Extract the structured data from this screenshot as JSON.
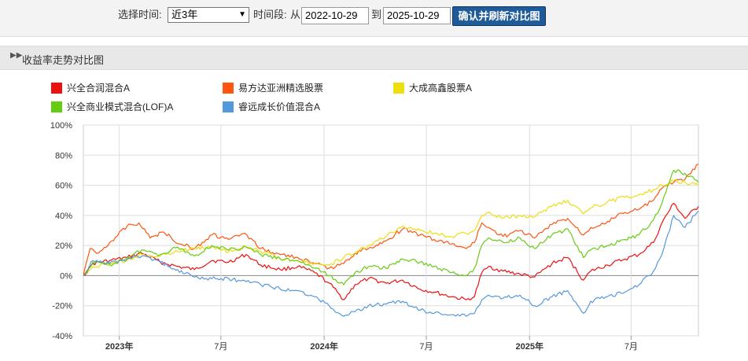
{
  "controls": {
    "period_label": "选择时间:",
    "period_value": "近3年",
    "range_label": "时间段:",
    "from_label": "从",
    "start_date": "2022-10-29",
    "to_label": "到",
    "end_date": "2025-10-29",
    "confirm_button": "确认并刷新对比图"
  },
  "section": {
    "title": "收益率走势对比图"
  },
  "chart_data": {
    "type": "line",
    "title": "",
    "xlabel": "",
    "ylabel": "",
    "x_range": [
      "2022-10-29",
      "2025-10-29"
    ],
    "ylim": [
      -40,
      100
    ],
    "yticks": [
      100,
      80,
      60,
      40,
      20,
      0,
      -20,
      -40
    ],
    "ytick_labels": [
      "100%",
      "80%",
      "60%",
      "40%",
      "20%",
      "0%",
      "-20%",
      "-40%"
    ],
    "xticks": [
      {
        "date": "2023-01-01",
        "label": "2023年",
        "bold": true
      },
      {
        "date": "2023-07-01",
        "label": "7月",
        "bold": false
      },
      {
        "date": "2024-01-01",
        "label": "2024年",
        "bold": true
      },
      {
        "date": "2024-07-01",
        "label": "7月",
        "bold": false
      },
      {
        "date": "2025-01-01",
        "label": "2025年",
        "bold": true
      },
      {
        "date": "2025-07-01",
        "label": "7月",
        "bold": false
      }
    ],
    "grid": true,
    "legend_position": "top",
    "series": [
      {
        "name": "兴全合润混合A",
        "color": "#ee1111",
        "points": [
          [
            "2022-10-29",
            0
          ],
          [
            "2022-11-15",
            8
          ],
          [
            "2022-12-15",
            10
          ],
          [
            "2023-01-15",
            12
          ],
          [
            "2023-02-10",
            15
          ],
          [
            "2023-03-15",
            9
          ],
          [
            "2023-04-15",
            6
          ],
          [
            "2023-05-15",
            4
          ],
          [
            "2023-06-15",
            10
          ],
          [
            "2023-07-15",
            9
          ],
          [
            "2023-08-15",
            14
          ],
          [
            "2023-09-10",
            7
          ],
          [
            "2023-10-15",
            4
          ],
          [
            "2023-11-15",
            6
          ],
          [
            "2023-12-15",
            2
          ],
          [
            "2024-01-10",
            -5
          ],
          [
            "2024-02-05",
            -16
          ],
          [
            "2024-02-25",
            -6
          ],
          [
            "2024-03-20",
            -2
          ],
          [
            "2024-04-20",
            -5
          ],
          [
            "2024-05-20",
            -3
          ],
          [
            "2024-06-20",
            -9
          ],
          [
            "2024-07-15",
            -11
          ],
          [
            "2024-08-15",
            -14
          ],
          [
            "2024-09-10",
            -16
          ],
          [
            "2024-09-25",
            -14
          ],
          [
            "2024-10-08",
            2
          ],
          [
            "2024-10-20",
            6
          ],
          [
            "2024-11-15",
            3
          ],
          [
            "2024-12-15",
            1
          ],
          [
            "2025-01-10",
            -1
          ],
          [
            "2025-02-10",
            8
          ],
          [
            "2025-03-10",
            12
          ],
          [
            "2025-04-07",
            -3
          ],
          [
            "2025-04-20",
            3
          ],
          [
            "2025-05-20",
            7
          ],
          [
            "2025-06-20",
            11
          ],
          [
            "2025-07-15",
            14
          ],
          [
            "2025-08-10",
            22
          ],
          [
            "2025-08-25",
            35
          ],
          [
            "2025-09-15",
            48
          ],
          [
            "2025-10-05",
            38
          ],
          [
            "2025-10-29",
            46
          ]
        ]
      },
      {
        "name": "易方达亚洲精选股票",
        "color": "#ff5511",
        "points": [
          [
            "2022-10-29",
            0
          ],
          [
            "2022-11-10",
            18
          ],
          [
            "2022-11-25",
            15
          ],
          [
            "2022-12-15",
            22
          ],
          [
            "2023-01-15",
            33
          ],
          [
            "2023-02-05",
            35
          ],
          [
            "2023-02-25",
            25
          ],
          [
            "2023-03-20",
            29
          ],
          [
            "2023-04-20",
            21
          ],
          [
            "2023-05-15",
            18
          ],
          [
            "2023-06-15",
            27
          ],
          [
            "2023-07-15",
            24
          ],
          [
            "2023-08-10",
            28
          ],
          [
            "2023-09-10",
            18
          ],
          [
            "2023-10-15",
            14
          ],
          [
            "2023-11-15",
            12
          ],
          [
            "2023-12-15",
            8
          ],
          [
            "2024-01-10",
            5
          ],
          [
            "2024-02-05",
            8
          ],
          [
            "2024-02-25",
            15
          ],
          [
            "2024-03-20",
            18
          ],
          [
            "2024-04-20",
            23
          ],
          [
            "2024-05-20",
            31
          ],
          [
            "2024-06-20",
            27
          ],
          [
            "2024-07-15",
            24
          ],
          [
            "2024-08-15",
            21
          ],
          [
            "2024-09-10",
            18
          ],
          [
            "2024-09-25",
            22
          ],
          [
            "2024-10-08",
            35
          ],
          [
            "2024-10-20",
            32
          ],
          [
            "2024-11-15",
            26
          ],
          [
            "2024-12-15",
            30
          ],
          [
            "2025-01-10",
            25
          ],
          [
            "2025-02-10",
            34
          ],
          [
            "2025-03-10",
            38
          ],
          [
            "2025-04-07",
            27
          ],
          [
            "2025-04-20",
            32
          ],
          [
            "2025-05-20",
            36
          ],
          [
            "2025-06-20",
            42
          ],
          [
            "2025-07-15",
            44
          ],
          [
            "2025-08-10",
            50
          ],
          [
            "2025-08-25",
            58
          ],
          [
            "2025-09-15",
            62
          ],
          [
            "2025-10-05",
            64
          ],
          [
            "2025-10-29",
            74
          ]
        ]
      },
      {
        "name": "大成高鑫股票A",
        "color": "#eedd11",
        "points": [
          [
            "2022-10-29",
            0
          ],
          [
            "2022-11-15",
            6
          ],
          [
            "2022-12-15",
            8
          ],
          [
            "2023-01-15",
            10
          ],
          [
            "2023-02-10",
            14
          ],
          [
            "2023-03-15",
            13
          ],
          [
            "2023-04-15",
            16
          ],
          [
            "2023-05-15",
            18
          ],
          [
            "2023-06-15",
            19
          ],
          [
            "2023-07-15",
            16
          ],
          [
            "2023-08-15",
            19
          ],
          [
            "2023-09-10",
            16
          ],
          [
            "2023-10-15",
            11
          ],
          [
            "2023-11-15",
            10
          ],
          [
            "2023-12-15",
            8
          ],
          [
            "2024-01-10",
            7
          ],
          [
            "2024-02-05",
            12
          ],
          [
            "2024-02-25",
            15
          ],
          [
            "2024-03-20",
            20
          ],
          [
            "2024-04-20",
            26
          ],
          [
            "2024-05-20",
            33
          ],
          [
            "2024-06-20",
            30
          ],
          [
            "2024-07-15",
            28
          ],
          [
            "2024-08-15",
            26
          ],
          [
            "2024-09-10",
            28
          ],
          [
            "2024-09-25",
            30
          ],
          [
            "2024-10-08",
            40
          ],
          [
            "2024-10-20",
            42
          ],
          [
            "2024-11-15",
            38
          ],
          [
            "2024-12-15",
            40
          ],
          [
            "2025-01-10",
            39
          ],
          [
            "2025-02-10",
            46
          ],
          [
            "2025-03-10",
            50
          ],
          [
            "2025-04-07",
            41
          ],
          [
            "2025-04-20",
            45
          ],
          [
            "2025-05-20",
            49
          ],
          [
            "2025-06-20",
            52
          ],
          [
            "2025-07-15",
            54
          ],
          [
            "2025-08-10",
            57
          ],
          [
            "2025-08-25",
            60
          ],
          [
            "2025-09-15",
            63
          ],
          [
            "2025-10-05",
            62
          ],
          [
            "2025-10-29",
            60
          ]
        ]
      },
      {
        "name": "兴全商业模式混合(LOF)A",
        "color": "#66cc11",
        "points": [
          [
            "2022-10-29",
            0
          ],
          [
            "2022-11-15",
            9
          ],
          [
            "2022-12-15",
            7
          ],
          [
            "2023-01-15",
            12
          ],
          [
            "2023-02-10",
            17
          ],
          [
            "2023-03-15",
            14
          ],
          [
            "2023-04-15",
            19
          ],
          [
            "2023-05-15",
            13
          ],
          [
            "2023-06-15",
            20
          ],
          [
            "2023-07-15",
            17
          ],
          [
            "2023-08-15",
            19
          ],
          [
            "2023-09-10",
            14
          ],
          [
            "2023-10-15",
            11
          ],
          [
            "2023-11-15",
            10
          ],
          [
            "2023-12-15",
            5
          ],
          [
            "2024-01-10",
            0
          ],
          [
            "2024-02-05",
            -6
          ],
          [
            "2024-02-25",
            2
          ],
          [
            "2024-03-20",
            6
          ],
          [
            "2024-04-20",
            5
          ],
          [
            "2024-05-20",
            11
          ],
          [
            "2024-06-20",
            9
          ],
          [
            "2024-07-15",
            6
          ],
          [
            "2024-08-15",
            2
          ],
          [
            "2024-09-10",
            0
          ],
          [
            "2024-09-25",
            5
          ],
          [
            "2024-10-08",
            20
          ],
          [
            "2024-10-20",
            25
          ],
          [
            "2024-11-15",
            22
          ],
          [
            "2024-12-15",
            25
          ],
          [
            "2025-01-10",
            18
          ],
          [
            "2025-02-10",
            27
          ],
          [
            "2025-03-10",
            31
          ],
          [
            "2025-04-07",
            12
          ],
          [
            "2025-04-20",
            17
          ],
          [
            "2025-05-20",
            20
          ],
          [
            "2025-06-20",
            24
          ],
          [
            "2025-07-15",
            27
          ],
          [
            "2025-08-10",
            37
          ],
          [
            "2025-08-25",
            48
          ],
          [
            "2025-09-15",
            70
          ],
          [
            "2025-10-05",
            68
          ],
          [
            "2025-10-29",
            62
          ]
        ]
      },
      {
        "name": "睿远成长价值混合A",
        "color": "#5599dd",
        "points": [
          [
            "2022-10-29",
            0
          ],
          [
            "2022-11-15",
            10
          ],
          [
            "2022-12-15",
            8
          ],
          [
            "2023-01-15",
            11
          ],
          [
            "2023-02-10",
            13
          ],
          [
            "2023-03-15",
            9
          ],
          [
            "2023-04-15",
            4
          ],
          [
            "2023-05-15",
            -1
          ],
          [
            "2023-06-15",
            -2
          ],
          [
            "2023-07-15",
            -2
          ],
          [
            "2023-08-15",
            -4
          ],
          [
            "2023-09-10",
            -6
          ],
          [
            "2023-10-15",
            -9
          ],
          [
            "2023-11-15",
            -10
          ],
          [
            "2023-12-15",
            -14
          ],
          [
            "2024-01-10",
            -20
          ],
          [
            "2024-02-05",
            -27
          ],
          [
            "2024-02-25",
            -24
          ],
          [
            "2024-03-20",
            -20
          ],
          [
            "2024-04-20",
            -19
          ],
          [
            "2024-05-20",
            -17
          ],
          [
            "2024-06-20",
            -23
          ],
          [
            "2024-07-15",
            -25
          ],
          [
            "2024-08-15",
            -26
          ],
          [
            "2024-09-10",
            -27
          ],
          [
            "2024-09-25",
            -25
          ],
          [
            "2024-10-08",
            -16
          ],
          [
            "2024-10-20",
            -13
          ],
          [
            "2024-11-15",
            -15
          ],
          [
            "2024-12-15",
            -13
          ],
          [
            "2025-01-10",
            -20
          ],
          [
            "2025-02-10",
            -14
          ],
          [
            "2025-03-10",
            -10
          ],
          [
            "2025-04-07",
            -25
          ],
          [
            "2025-04-20",
            -17
          ],
          [
            "2025-05-20",
            -14
          ],
          [
            "2025-06-20",
            -11
          ],
          [
            "2025-07-15",
            -6
          ],
          [
            "2025-08-10",
            3
          ],
          [
            "2025-08-25",
            14
          ],
          [
            "2025-09-15",
            40
          ],
          [
            "2025-10-05",
            32
          ],
          [
            "2025-10-29",
            43
          ]
        ]
      }
    ]
  }
}
